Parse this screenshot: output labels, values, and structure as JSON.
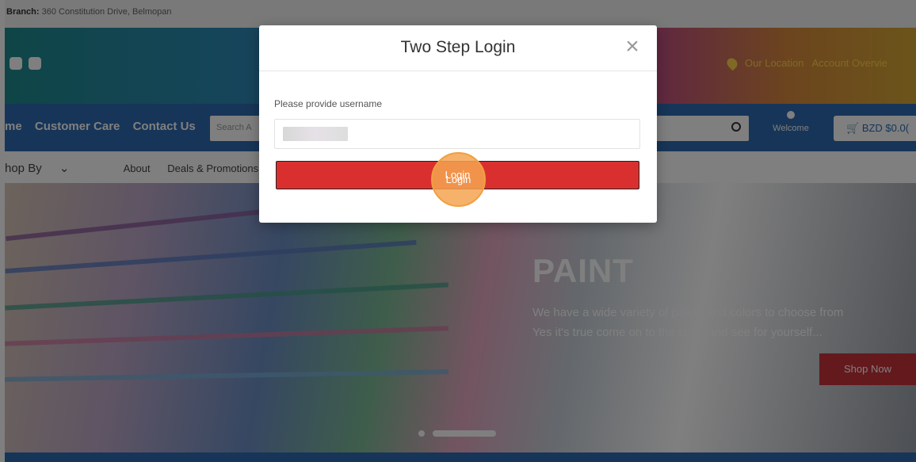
{
  "topbar": {
    "branch_label": "Branch:",
    "branch_address": "360 Constitution Drive, Belmopan"
  },
  "header": {
    "location_link": "Our Location",
    "account_link": "Account Overvie"
  },
  "nav": {
    "links": [
      "me",
      "Customer Care",
      "Contact Us"
    ],
    "search_placeholder": "Search A",
    "welcome": "Welcome",
    "cart": "BZD $0.0("
  },
  "subnav": {
    "shop_by": "hop By",
    "items": [
      "About",
      "Deals & Promotions"
    ]
  },
  "hero": {
    "title": "PAINT",
    "line1": "We have a wide variety of paints and colors to choose from",
    "line2": "Yes it's true come on to the store and see for yourself...",
    "cta": "Shop Now"
  },
  "modal": {
    "title": "Two Step Login",
    "close_glyph": "×",
    "field_label": "Please provide username",
    "login_button": "Login"
  },
  "colors": {
    "login_red": "#d9302f",
    "nav_blue": "#2f6ab0",
    "click_highlight": "#f4a450"
  }
}
